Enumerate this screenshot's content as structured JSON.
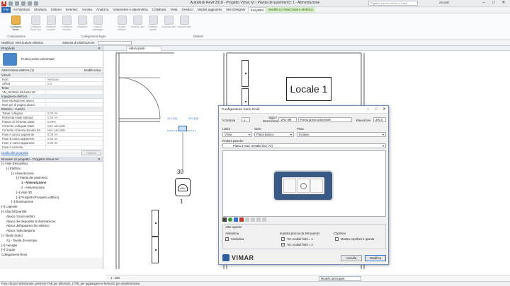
{
  "window": {
    "title": "Autodesk Revit 2018 -    Progetto Vimar.rvt - Pianta del pavimento: 1 - Alimentazione",
    "search_placeholder": "Digitare parole chiave o frase",
    "account": "Accedi"
  },
  "ribbon_tabs": [
    "File",
    "Architettura",
    "Struttura",
    "Sistemi",
    "Inserisci",
    "Annota",
    "Analizza",
    "Volumetrie e planimetria",
    "Collabora",
    "Vista",
    "Gestisci",
    "Moduli aggiuntivi",
    "Site Designer",
    "EasyBIM",
    "Modifica | Attrezzatura elettrica"
  ],
  "ribbon": {
    "buttons": [
      {
        "label": "Configura Vimar",
        "enabled": true
      },
      {
        "label": "Configura Vimar (in)",
        "enabled": false
      },
      {
        "label": "Gestione modulo",
        "enabled": false
      },
      {
        "label": "Collega a modulo",
        "enabled": false
      },
      {
        "label": "Disattiva",
        "enabled": false
      },
      {
        "label": "Lista di cablaggio",
        "enabled": false
      },
      {
        "label": "Quadri elettrici",
        "enabled": false
      },
      {
        "label": "Sezioni cavi",
        "enabled": false
      },
      {
        "label": "Disegno quadri",
        "enabled": false
      },
      {
        "label": "Esporta dati",
        "enabled": false
      },
      {
        "label": "Importa dati",
        "enabled": false
      }
    ],
    "groups": [
      "Composizioni",
      "Collegamenti logici",
      "Distinte"
    ]
  },
  "options_bar": {
    "context": "Modifica | Attrezzatura elettrica",
    "system": "Sistema di distribuzione:"
  },
  "properties": {
    "header": "Proprietà",
    "family": "Punto presa universale",
    "type_selector": "Attrezzatura elettrica (1)",
    "edit_type": "Modifica tipo",
    "rows": [
      {
        "k": "Vincoli",
        "v": "",
        "section": true
      },
      {
        "k": "Host",
        "v": "Nessuno"
      },
      {
        "k": "Offset",
        "v": "0.0"
      },
      {
        "k": "Testo",
        "v": "",
        "section": true
      },
      {
        "k": "VM_Simbolo etichetta 2D",
        "v": ""
      },
      {
        "k": "Ingegneria elettrica",
        "v": "",
        "section": true
      },
      {
        "k": "Note intestazione abaco",
        "v": ""
      },
      {
        "k": "Note piè di pagina abaco",
        "v": ""
      },
      {
        "k": "Elettrico - Carichi",
        "v": "",
        "section": true
      },
      {
        "k": "Totale collegato",
        "v": "0.00 VA"
      },
      {
        "k": "Richiesta totale stimata",
        "v": "0.00 VA"
      },
      {
        "k": "Fattore di richiesta totale",
        "v": "0.00%"
      },
      {
        "k": "Corrente collegata totale",
        "v": "Non calcolato"
      },
      {
        "k": "Corrente richiesta stimata tot...",
        "v": "Non calcolato"
      },
      {
        "k": "Fase A carico apparente",
        "v": "0.00 VA"
      },
      {
        "k": "Fase B carico apparente",
        "v": "0.00 VA"
      },
      {
        "k": "Fase C carico apparente",
        "v": "0.00 VA"
      },
      {
        "k": "Fase A corrente",
        "v": ""
      }
    ],
    "help": "Guida alle proprietà",
    "apply": "Applica"
  },
  "browser": {
    "header": "Browser di progetto - Progetto Vimar.rvt",
    "items": [
      {
        "label": "Viste (Disciplina)",
        "indent": 0,
        "sign": "-"
      },
      {
        "label": "Elettrico",
        "indent": 1,
        "sign": "-"
      },
      {
        "label": "Alimentazione",
        "indent": 2,
        "sign": "-"
      },
      {
        "label": "Pianta dei pavimenti",
        "indent": 3,
        "sign": "-"
      },
      {
        "label": "1 - Alimentazione",
        "indent": 4,
        "sign": "",
        "bold": true
      },
      {
        "label": "2 - Alimentazione",
        "indent": 4,
        "sign": ""
      },
      {
        "label": "Viste 3D",
        "indent": 3,
        "sign": "+"
      },
      {
        "label": "Prospetti (Prospetto edificio)",
        "indent": 3,
        "sign": "+"
      },
      {
        "label": "Illuminazione",
        "indent": 2,
        "sign": "+"
      },
      {
        "label": "Legende",
        "indent": 0,
        "sign": "+"
      },
      {
        "label": "Abachi/Quantità",
        "indent": 0,
        "sign": "-"
      },
      {
        "label": "Abaco circuiti elettrici",
        "indent": 1,
        "sign": ""
      },
      {
        "label": "Abaco dei dispositivi di illuminazione",
        "indent": 1,
        "sign": ""
      },
      {
        "label": "Abaco dell'apparecchio elettrico",
        "indent": 1,
        "sign": ""
      },
      {
        "label": "Abaco multicategoria",
        "indent": 1,
        "sign": ""
      },
      {
        "label": "Tavole (tutto)",
        "indent": 0,
        "sign": "-"
      },
      {
        "label": "A1 - Tavola di esempio",
        "indent": 1,
        "sign": ""
      },
      {
        "label": "Famiglie",
        "indent": 0,
        "sign": "+"
      },
      {
        "label": "Gruppi",
        "indent": 0,
        "sign": "+"
      },
      {
        "label": "Collegamenti Revit",
        "indent": 0,
        "sign": ""
      }
    ]
  },
  "view": {
    "tab": "Attiva quote",
    "room_label": "Locale 1",
    "symbol_number": "30",
    "symbol_text": "UNV",
    "symbol_index": "1",
    "dimension_left": "25.0 [25]",
    "dimension_right": "25.0 [25]",
    "scale": "1 : 100",
    "model": "Modello principale"
  },
  "dialog": {
    "title": "Configuratore Serie Civili",
    "n_scatola_label": "N Scatola",
    "n_scatola": "1",
    "sigla_label": "Sigla / Descrizione",
    "sigla": "1PU-3M",
    "descrizione": "Punto presa universale",
    "elevazione_label": "Elevazione",
    "elevazione": "300.0",
    "listini_label": "Listini",
    "listini": "Vimar",
    "serie_label": "Serie",
    "serie": "Plana Bianco",
    "posa_label": "Posa",
    "posa": "Incasso",
    "finiture_label": "Finiture placche",
    "finitura": "Plana 3 mod. metallo blu ( 73)",
    "options_title": "Altre opzioni",
    "anteprima_label": "Anteprima",
    "simbolica": "Simbolica",
    "imposta_label": "Imposta placca da 3M quando",
    "opt1": "Tot. moduli frutti = 1",
    "opt2": "Tot. moduli frutti = 2",
    "copriforo_label": "Copriforo",
    "copriforo": "Mostra copriforo in pianta",
    "brand": "VIMAR",
    "cancel": "Annulla",
    "ok": "Modifica"
  },
  "status": "Fare clic per selezionare, premere TAB per alternare, CTRL per aggiungere e MAIUSC per deselezionare.",
  "colors": {
    "file_tab": "#2c6bb8",
    "context_tab": "#d7f0c7",
    "selection": "#2f6fd6",
    "plate": "#3a5a86"
  }
}
